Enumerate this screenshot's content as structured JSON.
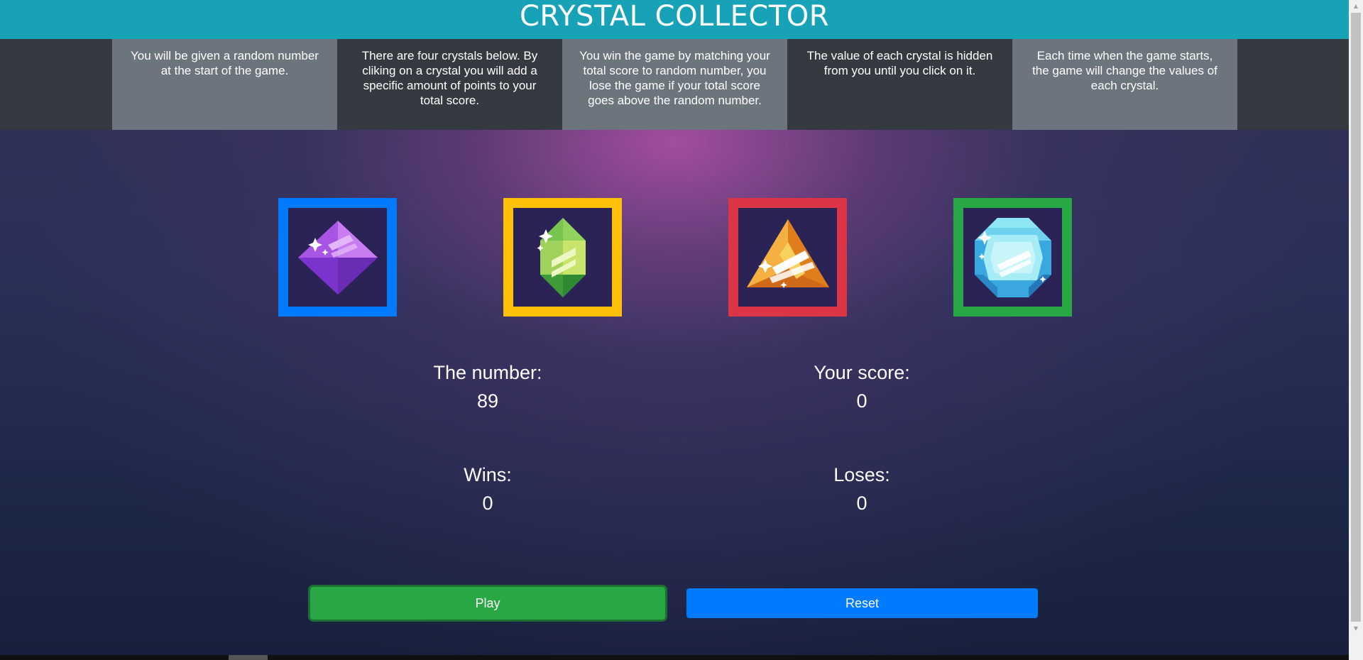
{
  "header": {
    "title": "CRYSTAL COLLECTOR"
  },
  "rules": [
    "You will be given a random number at the start of the game.",
    "There are four crystals below. By cliking on a crystal you will add a specific amount of points to your total score.",
    "You win the game by matching your total score to random number, you lose the game if your total score goes above the random number.",
    "The value of each crystal is hidden from you until you click on it.",
    "Each time when the game starts, the game will change the values of each crystal."
  ],
  "crystals": [
    {
      "name": "purple-crystal",
      "icon": "purple-octahedron-gem-icon",
      "border_color": "#007bff"
    },
    {
      "name": "green-crystal",
      "icon": "green-hexagonal-gem-icon",
      "border_color": "#ffc107"
    },
    {
      "name": "orange-crystal",
      "icon": "orange-pyramid-gem-icon",
      "border_color": "#dc3545"
    },
    {
      "name": "blue-crystal",
      "icon": "blue-round-gem-icon",
      "border_color": "#28a745"
    }
  ],
  "stats": {
    "number_label": "The number:",
    "number_value": "89",
    "score_label": "Your score:",
    "score_value": "0",
    "wins_label": "Wins:",
    "wins_value": "0",
    "loses_label": "Loses:",
    "loses_value": "0"
  },
  "buttons": {
    "play": "Play",
    "reset": "Reset"
  },
  "colors": {
    "header": "#17a2b8",
    "rule_gray": "#6c757d",
    "rule_dark": "#343a40",
    "play": "#28a745",
    "reset": "#007bff"
  }
}
